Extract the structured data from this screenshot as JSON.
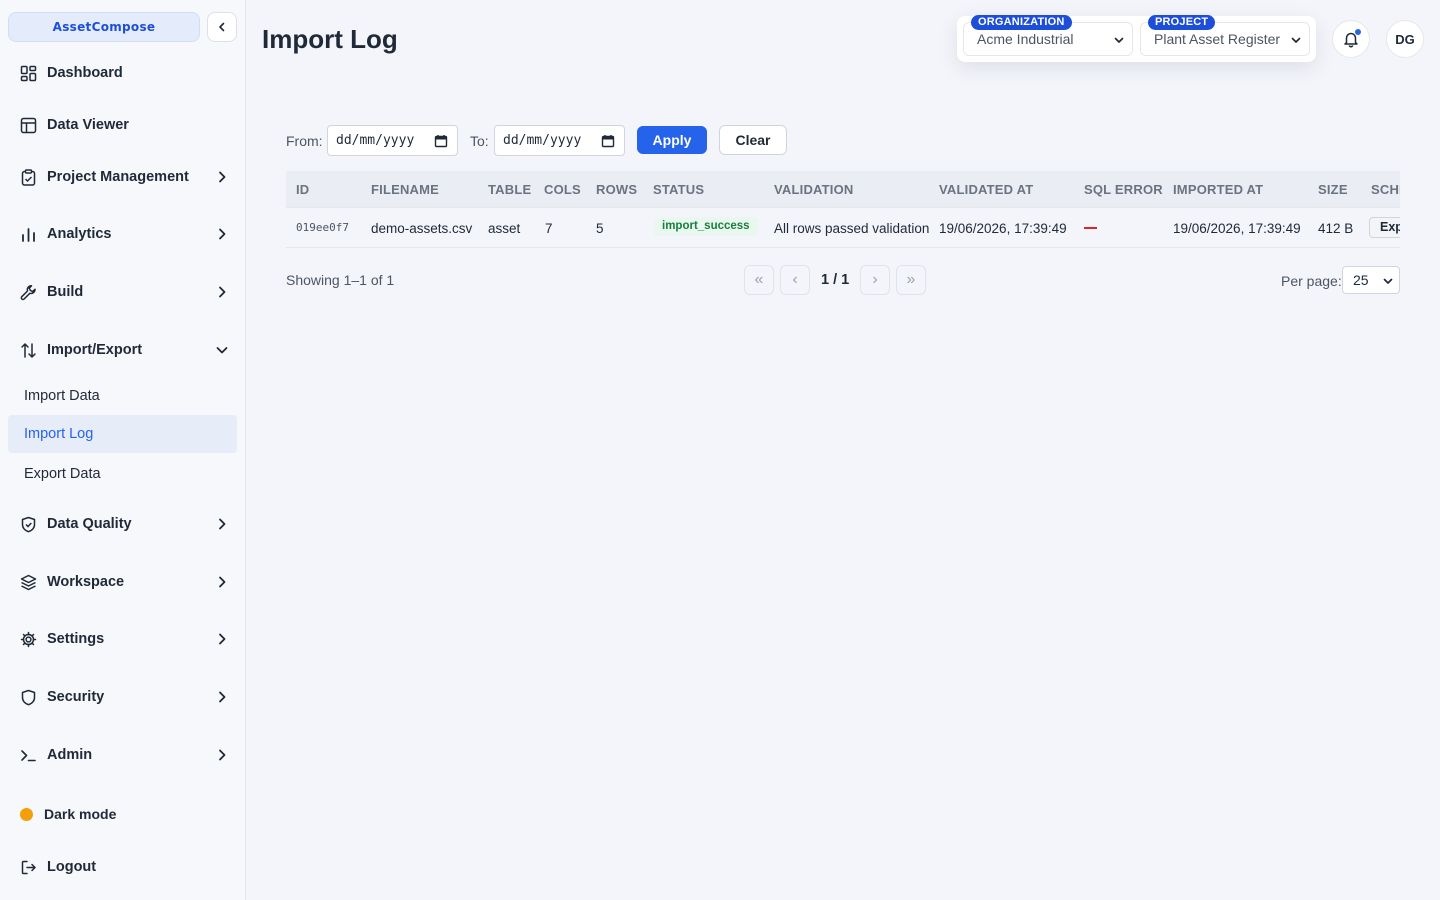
{
  "app": {
    "brand": "AssetCompose"
  },
  "sidebar": {
    "items": [
      {
        "label": "Dashboard"
      },
      {
        "label": "Data Viewer"
      },
      {
        "label": "Project Management"
      },
      {
        "label": "Analytics"
      },
      {
        "label": "Build"
      },
      {
        "label": "Import/Export"
      },
      {
        "label": "Data Quality"
      },
      {
        "label": "Workspace"
      },
      {
        "label": "Settings"
      },
      {
        "label": "Security"
      },
      {
        "label": "Admin"
      },
      {
        "label": "Dark mode"
      },
      {
        "label": "Logout"
      }
    ],
    "import_export_sub": [
      {
        "label": "Import Data"
      },
      {
        "label": "Import Log"
      },
      {
        "label": "Export Data"
      }
    ]
  },
  "header": {
    "title": "Import Log",
    "organization": {
      "badge": "ORGANIZATION",
      "value": "Acme Industrial"
    },
    "project": {
      "badge": "PROJECT",
      "value": "Plant Asset Register"
    },
    "avatar": "DG"
  },
  "filters": {
    "from_label": "From:",
    "to_label": "To:",
    "from_value": "dd/mm/yyyy",
    "to_value": "dd/mm/yyyy",
    "apply": "Apply",
    "clear": "Clear"
  },
  "table": {
    "columns": [
      "ID",
      "FILENAME",
      "TABLE",
      "COLS",
      "ROWS",
      "STATUS",
      "VALIDATION",
      "VALIDATED AT",
      "SQL ERROR",
      "IMPORTED AT",
      "SIZE",
      "SCHEMA"
    ],
    "rows": [
      {
        "id": "019ee0f7",
        "filename": "demo-assets.csv",
        "table": "asset",
        "cols": "7",
        "rows": "5",
        "status": "import_success",
        "validation": "All rows passed validation",
        "validated_at": "19/06/2026, 17:39:49",
        "sql_error": "—",
        "imported_at": "19/06/2026, 17:39:49",
        "size": "412 B",
        "schema_action": "Export"
      }
    ]
  },
  "pagination": {
    "showing": "Showing 1–1 of 1",
    "page": "1 / 1",
    "first": "«",
    "prev": "‹",
    "next": "›",
    "last": "»",
    "per_page_label": "Per page:",
    "per_page_value": "25"
  },
  "colors": {
    "accent": "#2563eb",
    "success": "#15803d",
    "error": "#dc2626",
    "dark_mode_dot": "#f59e0b"
  }
}
